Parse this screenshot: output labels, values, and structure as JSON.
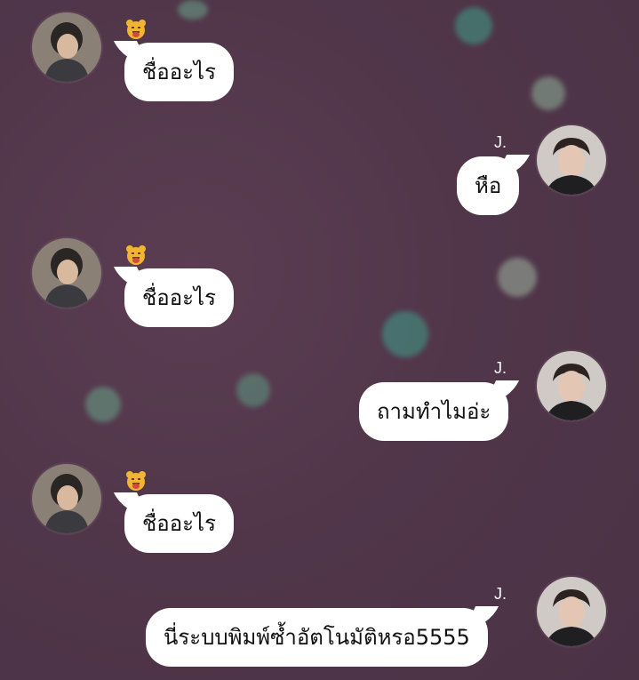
{
  "background_color": "#51364a",
  "bubble_color": "#ffffff",
  "messages": [
    {
      "side": "left",
      "sender_badge": "tiger-emoji-icon",
      "text": "ชื่ออะไร"
    },
    {
      "side": "right",
      "sender_name": "J.",
      "text": "หือ"
    },
    {
      "side": "left",
      "sender_badge": "tiger-emoji-icon",
      "text": "ชื่ออะไร"
    },
    {
      "side": "right",
      "sender_name": "J.",
      "text": "ถามทำไมอ่ะ"
    },
    {
      "side": "left",
      "sender_badge": "tiger-emoji-icon",
      "text": "ชื่ออะไร"
    },
    {
      "side": "right",
      "sender_name": "J.",
      "text": "นี่ระบบพิมพ์ซ้ำอัตโนมัติหรอ5555"
    }
  ]
}
